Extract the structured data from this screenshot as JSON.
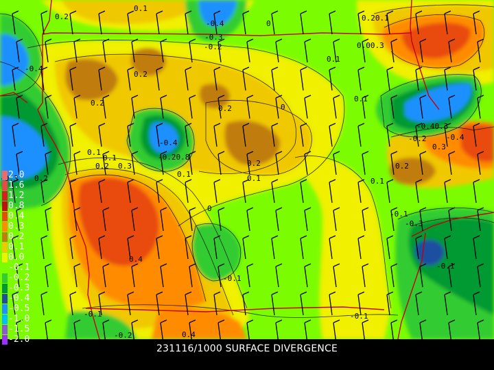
{
  "footer": {
    "title": "231116/1000 SURFACE DIVERGENCE"
  },
  "legend": {
    "items": [
      {
        "label": "2.0",
        "color": "#f06a6a"
      },
      {
        "label": "1.6",
        "color": "#e84a4a"
      },
      {
        "label": "1.2",
        "color": "#d62020"
      },
      {
        "label": "0.8",
        "color": "#c01010"
      },
      {
        "label": "0.4",
        "color": "#e84b0a"
      },
      {
        "label": "0.3",
        "color": "#ff8c00"
      },
      {
        "label": "0.2",
        "color": "#c07d10"
      },
      {
        "label": "0.1",
        "color": "#f0c800"
      },
      {
        "label": "0.0",
        "color": "#f0f000"
      },
      {
        "label": "-0.1",
        "color": "#7cfc00"
      },
      {
        "label": "-0.2",
        "color": "#33cc33"
      },
      {
        "label": "-0.3",
        "color": "#009933"
      },
      {
        "label": "-0.4",
        "color": "#1e4fa0"
      },
      {
        "label": "-0.5",
        "color": "#1e90ff"
      },
      {
        "label": "-1.0",
        "color": "#00bfff"
      },
      {
        "label": "-1.5",
        "color": "#8a5cd0"
      },
      {
        "label": "-2.0",
        "color": "#9b30ff"
      }
    ]
  },
  "map": {
    "contour_labels": [
      "0.2",
      "0.1",
      "-0.4",
      "-0.3",
      "-0.2",
      "0",
      "0.20.1",
      "0.00.3",
      "-0.4",
      "0.1",
      "0.2",
      "0.2",
      "0.1",
      "0.2",
      "0",
      "-0.4",
      "-0.40.3",
      "-0.2",
      "0.3",
      "-0.4",
      "0.1",
      "0.2",
      "0.3",
      "0.2",
      "0.1",
      "-0.20.8",
      "0.2",
      "0.1",
      "0.1",
      "0.2",
      "0.1",
      "-0.1",
      "-0.3",
      "0.4",
      "-0.1",
      "0",
      "-0.1",
      "-0.1",
      "-0.1",
      "0.4",
      "-0.2",
      "-0.3"
    ]
  }
}
